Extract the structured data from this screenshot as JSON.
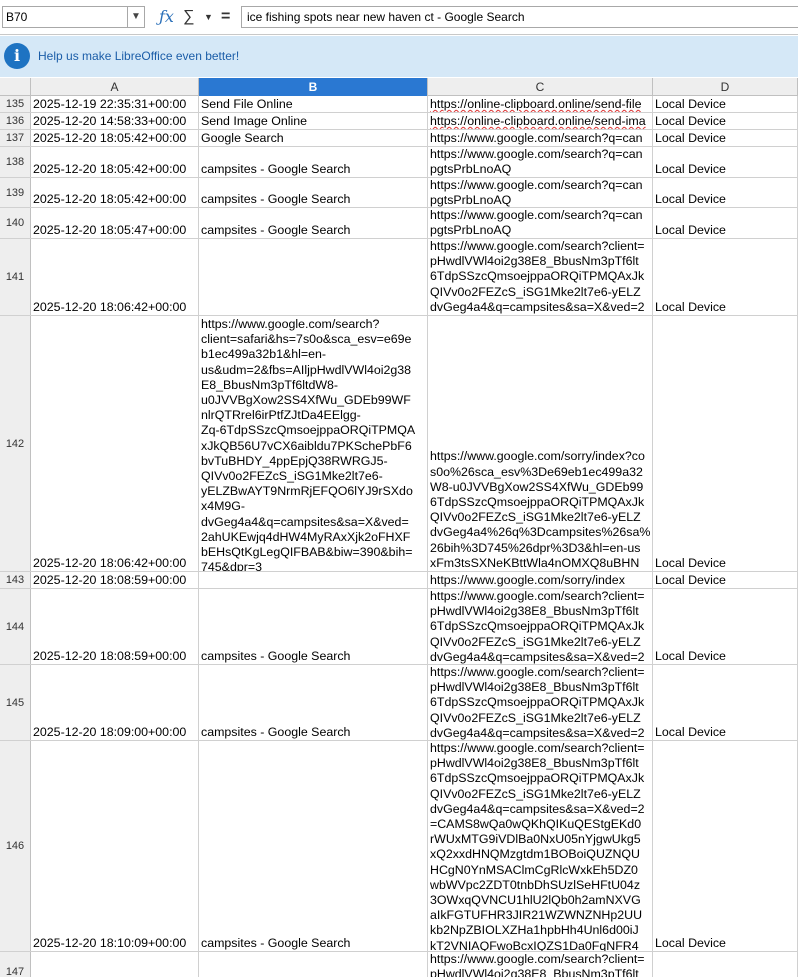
{
  "name_box": {
    "value": "B70"
  },
  "formula_bar": {
    "content": "ice fishing spots near new haven ct - Google Search",
    "fx_symbol": "ƒx",
    "sum_symbol": "∑",
    "equals_symbol": "="
  },
  "infobar": {
    "message": "Help us make LibreOffice even better!"
  },
  "columns": [
    {
      "label": "A",
      "selected": false
    },
    {
      "label": "B",
      "selected": true
    },
    {
      "label": "C",
      "selected": false
    },
    {
      "label": "D",
      "selected": false
    }
  ],
  "rows": [
    {
      "num": "135",
      "a": "2025-12-19 22:35:31+00:00",
      "b": "Send File Online",
      "c": "https://online-clipboard.online/send-file",
      "d": "Local Device"
    },
    {
      "num": "136",
      "a": "2025-12-20 14:58:33+00:00",
      "b": "Send Image Online",
      "c": "https://online-clipboard.online/send-ima",
      "d": "Local Device"
    },
    {
      "num": "137",
      "a": "2025-12-20 18:05:42+00:00",
      "b": "Google Search",
      "c": "https://www.google.com/search?q=can",
      "d": "Local Device"
    },
    {
      "num": "138",
      "a": "2025-12-20 18:05:42+00:00",
      "b": "campsites - Google Search",
      "c": "https://www.google.com/search?q=can\npgtsPrbLnoAQ",
      "d": "Local Device"
    },
    {
      "num": "139",
      "a": "2025-12-20 18:05:42+00:00",
      "b": "campsites - Google Search",
      "c": "https://www.google.com/search?q=can\npgtsPrbLnoAQ",
      "d": "Local Device"
    },
    {
      "num": "140",
      "a": "2025-12-20 18:05:47+00:00",
      "b": "campsites - Google Search",
      "c": "https://www.google.com/search?q=can\npgtsPrbLnoAQ",
      "d": "Local Device"
    },
    {
      "num": "141",
      "a": "2025-12-20 18:06:42+00:00",
      "b": "",
      "c": "https://www.google.com/search?client=\npHwdlVWl4oi2g38E8_BbusNm3pTf6lt\n6TdpSSzcQmsoejppaORQiTPMQAxJk\nQIVv0o2FEZcS_iSG1Mke2lt7e6-yELZ\ndvGeg4a4&q=campsites&sa=X&ved=2",
      "d": "Local Device"
    },
    {
      "num": "142",
      "a": "2025-12-20 18:06:42+00:00",
      "b": "https://www.google.com/search?\nclient=safari&hs=7s0o&sca_esv=e69e\nb1ec499a32b1&hl=en-\nus&udm=2&fbs=AIljpHwdlVWl4oi2g38\nE8_BbusNm3pTf6ltdW8-\nu0JVVBgXow2SS4XfWu_GDEb99WF\nnlrQTRrel6irPtfZJtDa4EElgg-\nZq-6TdpSSzcQmsoejppaORQiTPMQA\nxJkQB56U7vCX6aibldu7PKSchePbF6\nbvTuBHDY_4ppEpjQ38RWRGJ5-\nQIVv0o2FEZcS_iSG1Mke2lt7e6-\nyELZBwAYT9NrmRjEFQO6lYJ9rSXdo\nx4M9G-\ndvGeg4a4&q=campsites&sa=X&ved=\n2ahUKEwjq4dHW4MyRAxXjk2oFHXF\nbEHsQtKgLegQIFBAB&biw=390&bih=\n745&dpr=3",
      "c": "https://www.google.com/sorry/index?co\ns0o%26sca_esv%3De69eb1ec499a32\nW8-u0JVVBgXow2SS4XfWu_GDEb99\n6TdpSSzcQmsoejppaORQiTPMQAxJk\nQIVv0o2FEZcS_iSG1Mke2lt7e6-yELZ\ndvGeg4a4%26q%3Dcampsites%26sa%\n26bih%3D745%26dpr%3D3&hl=en-us\nxFm3tsSXNeKBttWla4nOMXQ8uBHN",
      "d": "Local Device"
    },
    {
      "num": "143",
      "a": "2025-12-20 18:08:59+00:00",
      "b": "",
      "c": "https://www.google.com/sorry/index",
      "d": "Local Device"
    },
    {
      "num": "144",
      "a": "2025-12-20 18:08:59+00:00",
      "b": "campsites - Google Search",
      "c": "https://www.google.com/search?client=\npHwdlVWl4oi2g38E8_BbusNm3pTf6lt\n6TdpSSzcQmsoejppaORQiTPMQAxJk\nQIVv0o2FEZcS_iSG1Mke2lt7e6-yELZ\ndvGeg4a4&q=campsites&sa=X&ved=2",
      "d": "Local Device"
    },
    {
      "num": "145",
      "a": "2025-12-20 18:09:00+00:00",
      "b": "campsites - Google Search",
      "c": "https://www.google.com/search?client=\npHwdlVWl4oi2g38E8_BbusNm3pTf6lt\n6TdpSSzcQmsoejppaORQiTPMQAxJk\nQIVv0o2FEZcS_iSG1Mke2lt7e6-yELZ\ndvGeg4a4&q=campsites&sa=X&ved=2",
      "d": "Local Device"
    },
    {
      "num": "146",
      "a": "2025-12-20 18:10:09+00:00",
      "b": "campsites - Google Search",
      "c": "https://www.google.com/search?client=\npHwdlVWl4oi2g38E8_BbusNm3pTf6lt\n6TdpSSzcQmsoejppaORQiTPMQAxJk\nQIVv0o2FEZcS_iSG1Mke2lt7e6-yELZ\ndvGeg4a4&q=campsites&sa=X&ved=2\n=CAMS8wQa0wQKhQIKuQEStgEKd0\nrWUxMTG9iVDlBa0NxU05nYjgwUkg5\nxQ2xxdHNQMzgtdm1BOBoiQUZNQU\nHCgN0YnMSAClmCgRlcWxkEh5DZ0\nwbWVpc2ZDT0tnbDhSUzlSeHFtU04z\n3OWxqQVNCU1hlU2lQb0h2amNXVG\naIkFGTUFHR3JIR21WZWNZNHp2UU\nkb2NpZBIOLXZHa1hpbHh4Unl6d00iJ\nkT2VNIAQFwoBcxIQZS1Da0FqNFR4",
      "d": "Local Device"
    },
    {
      "num": "147",
      "a": "",
      "b": "",
      "c": "https://www.google.com/search?client=\npHwdlVWl4oi2g38E8_BbusNm3pTf6lt",
      "d": ""
    }
  ]
}
